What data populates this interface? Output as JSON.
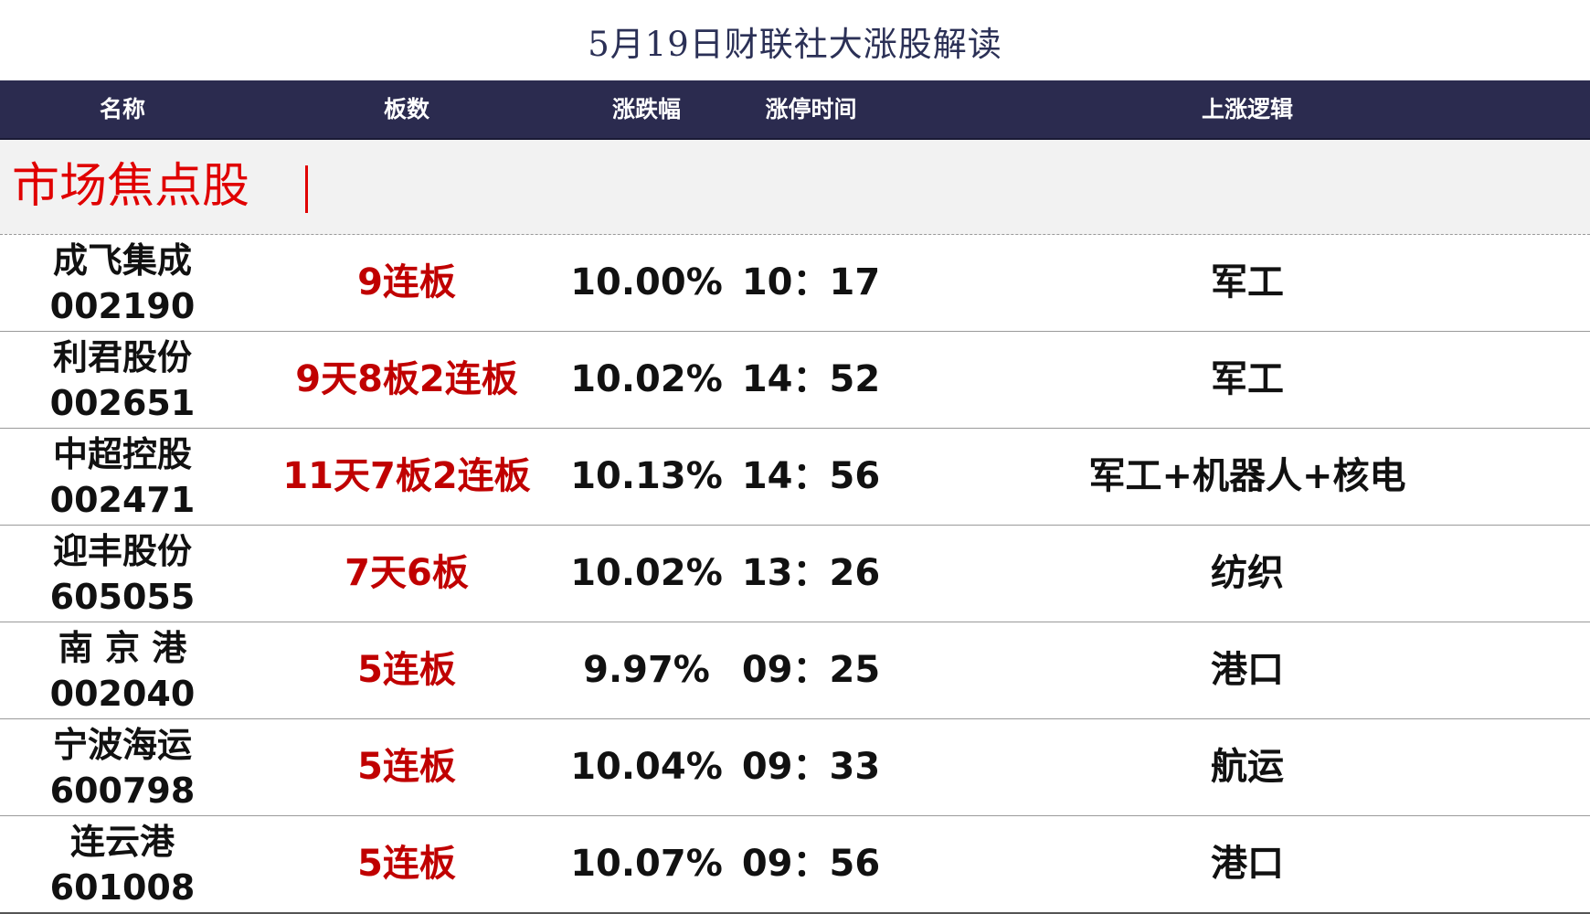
{
  "title": "5月19日财联社大涨股解读",
  "header": {
    "name": "名称",
    "boards": "板数",
    "change": "涨跌幅",
    "limit_time": "涨停时间",
    "logic": "上涨逻辑"
  },
  "section": {
    "title": "市场焦点股"
  },
  "colors": {
    "header_bg": "#2b2b4f",
    "section_title": "#e00000",
    "boards_text": "#c00000"
  },
  "rows": [
    {
      "name": "成飞集成",
      "code": "002190",
      "boards": "9连板",
      "change": "10.00%",
      "time": "10：17",
      "logic": "军工"
    },
    {
      "name": "利君股份",
      "code": "002651",
      "boards": "9天8板2连板",
      "change": "10.02%",
      "time": "14：52",
      "logic": "军工"
    },
    {
      "name": "中超控股",
      "code": "002471",
      "boards": "11天7板2连板",
      "change": "10.13%",
      "time": "14：56",
      "logic": "军工+机器人+核电"
    },
    {
      "name": "迎丰股份",
      "code": "605055",
      "boards": "7天6板",
      "change": "10.02%",
      "time": "13：26",
      "logic": "纺织"
    },
    {
      "name": "南 京 港",
      "code": "002040",
      "boards": "5连板",
      "change": "9.97%",
      "time": "09：25",
      "logic": "港口"
    },
    {
      "name": "宁波海运",
      "code": "600798",
      "boards": "5连板",
      "change": "10.04%",
      "time": "09：33",
      "logic": "航运"
    },
    {
      "name": "连云港",
      "code": "601008",
      "boards": "5连板",
      "change": "10.07%",
      "time": "09：56",
      "logic": "港口"
    }
  ]
}
